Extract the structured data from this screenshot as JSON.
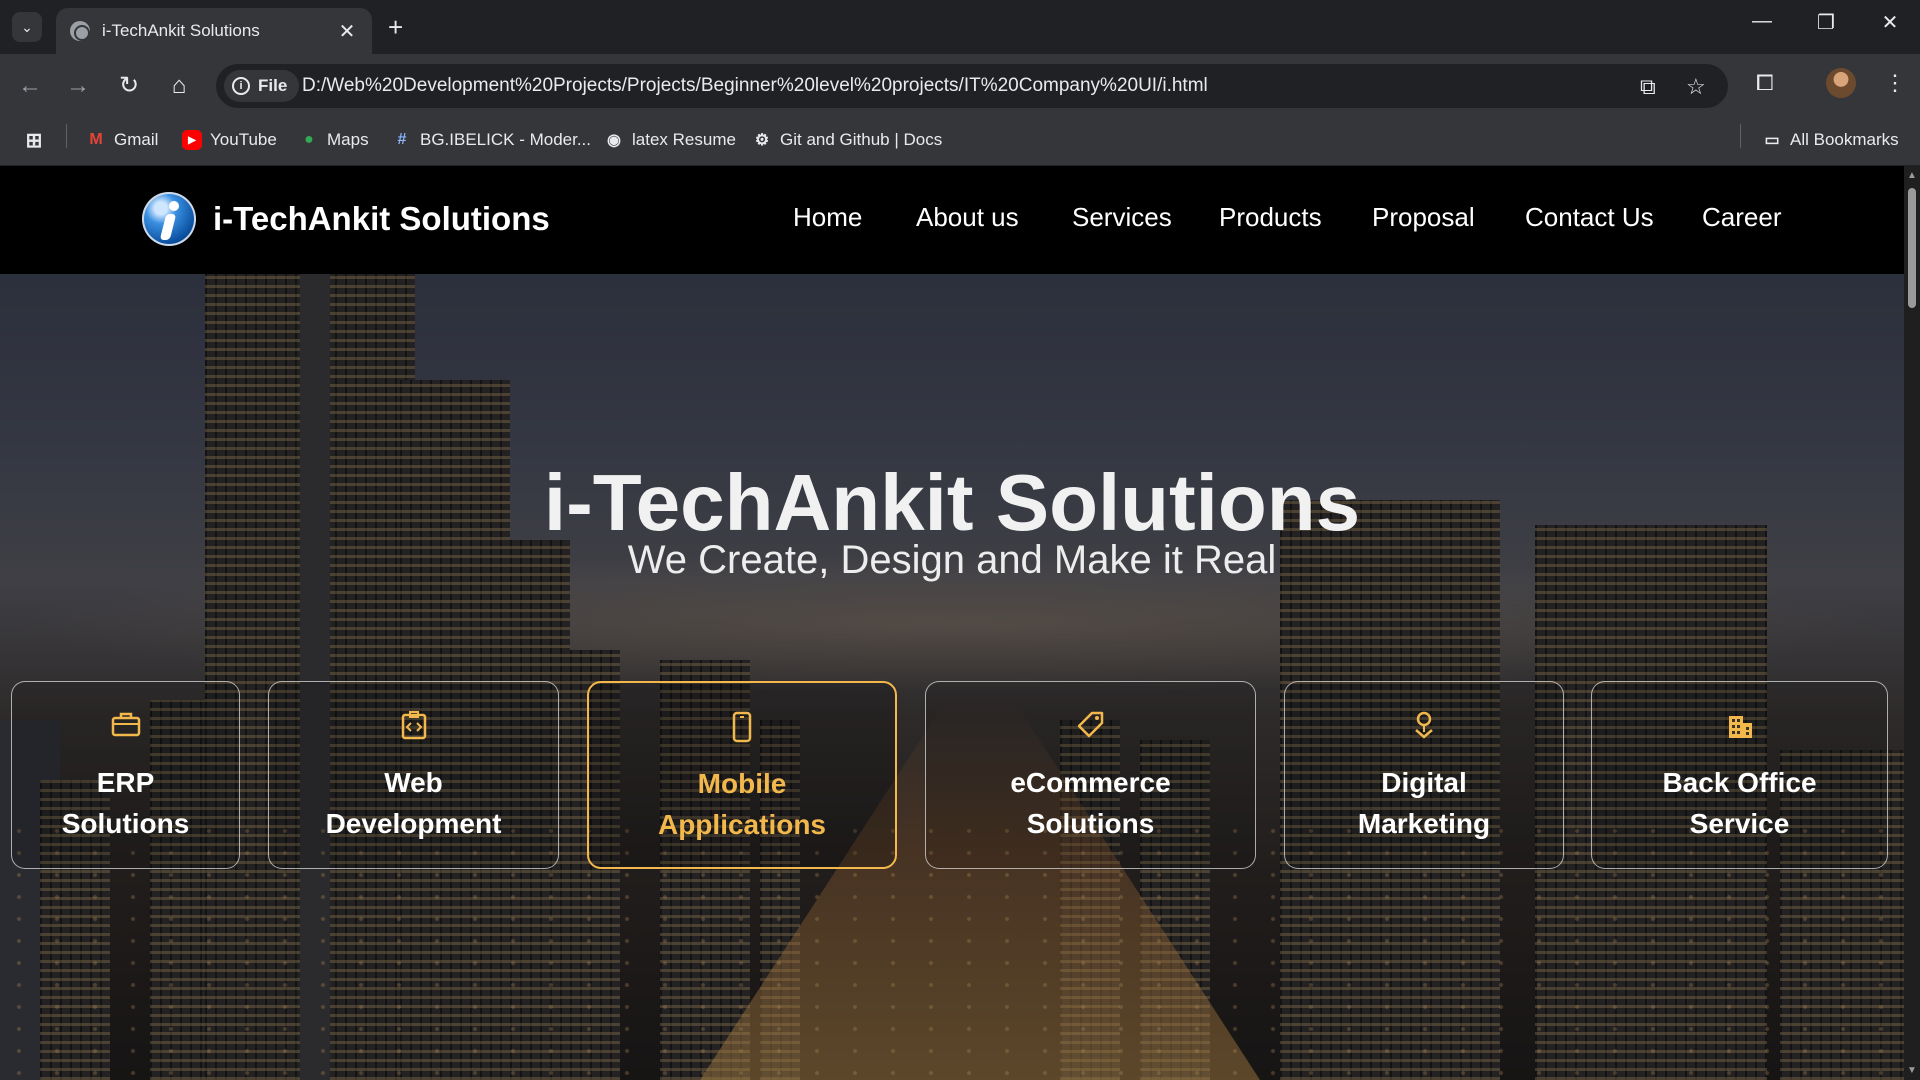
{
  "browser": {
    "tab_title": "i-TechAnkit Solutions",
    "omnibox": {
      "scheme_chip": "File",
      "url": "D:/Web%20Development%20Projects/Projects/Beginner%20level%20projects/IT%20Company%20UI/i.html"
    },
    "bookmarks": [
      {
        "label": "Gmail",
        "icon": "gmail-icon",
        "color": "#ea4335"
      },
      {
        "label": "YouTube",
        "icon": "youtube-icon",
        "color": "#ff0000"
      },
      {
        "label": "Maps",
        "icon": "maps-icon",
        "color": "#34a853"
      },
      {
        "label": "BG.IBELICK - Moder...",
        "icon": "hashtag-icon",
        "color": "#8ab4f8"
      },
      {
        "label": "latex Resume",
        "icon": "overleaf-icon",
        "color": "#e8eaed"
      },
      {
        "label": "Git and Github | Docs",
        "icon": "gear-icon",
        "color": "#e8eaed"
      }
    ],
    "all_bookmarks": "All Bookmarks"
  },
  "site": {
    "brand": "i-TechAnkit Solutions",
    "nav": [
      "Home",
      "About us",
      "Services",
      "Products",
      "Proposal",
      "Contact Us",
      "Career"
    ],
    "hero": {
      "title": "i-TechAnkit Solutions",
      "subtitle": "We Create, Design and Make it Real"
    },
    "services": [
      {
        "label": "ERP\nSolutions",
        "icon": "briefcase-icon",
        "active": false
      },
      {
        "label": "Web\nDevelopment",
        "icon": "code-file-icon",
        "active": false
      },
      {
        "label": "Mobile\nApplications",
        "icon": "mobile-icon",
        "active": true
      },
      {
        "label": "eCommerce\nSolutions",
        "icon": "tag-icon",
        "active": false
      },
      {
        "label": "Digital\nMarketing",
        "icon": "location-pin-icon",
        "active": false
      },
      {
        "label": "Back Office\nService",
        "icon": "building-icon",
        "active": false
      }
    ],
    "accent_color": "#f2b84b"
  }
}
